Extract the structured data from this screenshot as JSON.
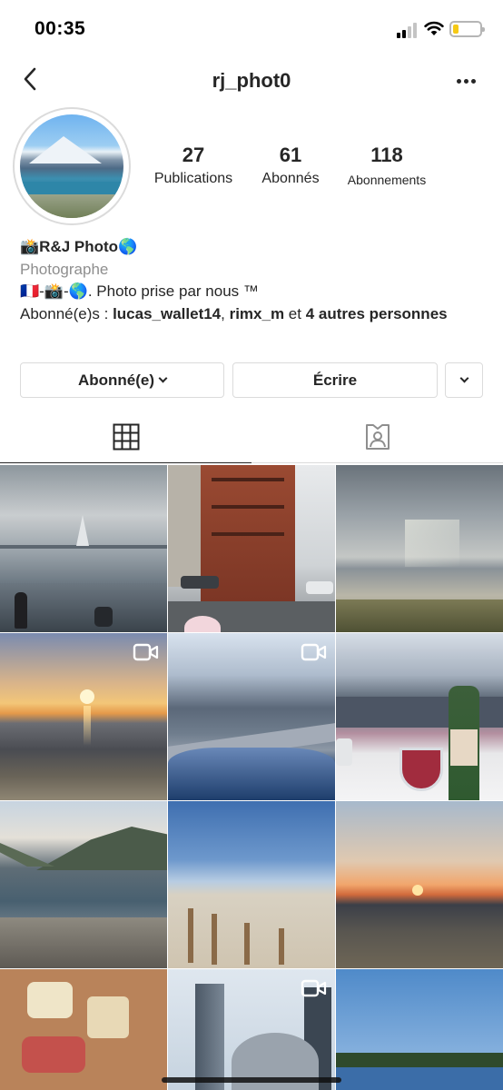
{
  "status_bar": {
    "time": "00:35",
    "battery_level": 0.22
  },
  "header": {
    "username": "rj_phot0",
    "back_icon": "chevron-left-icon",
    "more_icon": "more-horizontal-icon"
  },
  "stats": [
    {
      "value": "27",
      "label": "Publications"
    },
    {
      "value": "61",
      "label": "Abonnés"
    },
    {
      "value": "118",
      "label": "Abonnements"
    }
  ],
  "bio": {
    "name": "📸R&J Photo🌎",
    "category": "Photographe",
    "description": "🇫🇷-📸-🌎. Photo prise par nous ™",
    "followed_by_prefix": "Abonné(e)s : ",
    "followed_by_user1": "lucas_wallet14",
    "followed_by_sep": ", ",
    "followed_by_user2": "rimx_m",
    "followed_by_and": " et ",
    "followed_by_others": "4 autres personnes"
  },
  "buttons": {
    "follow": "Abonné(e)",
    "message": "Écrire"
  },
  "tabs": {
    "grid_icon": "grid-icon",
    "tagged_icon": "tagged-person-icon"
  },
  "colors": {
    "text": "#262626",
    "secondary": "#8e8e8e",
    "border": "#dbdbdb",
    "battery": "#f5c916"
  },
  "posts": [
    {
      "label": "lake-boat",
      "video": false
    },
    {
      "label": "red-building-street",
      "video": false
    },
    {
      "label": "beach-sunrays",
      "video": false
    },
    {
      "label": "sunset-beach",
      "video": true
    },
    {
      "label": "mountain-road",
      "video": true
    },
    {
      "label": "mountain-wine",
      "video": false
    },
    {
      "label": "mountain-lake",
      "video": false
    },
    {
      "label": "dune-fence",
      "video": false
    },
    {
      "label": "sunset-sea",
      "video": false
    },
    {
      "label": "charcuterie-board",
      "video": false
    },
    {
      "label": "city-towers",
      "video": true
    },
    {
      "label": "harbor-pines",
      "video": false
    }
  ]
}
